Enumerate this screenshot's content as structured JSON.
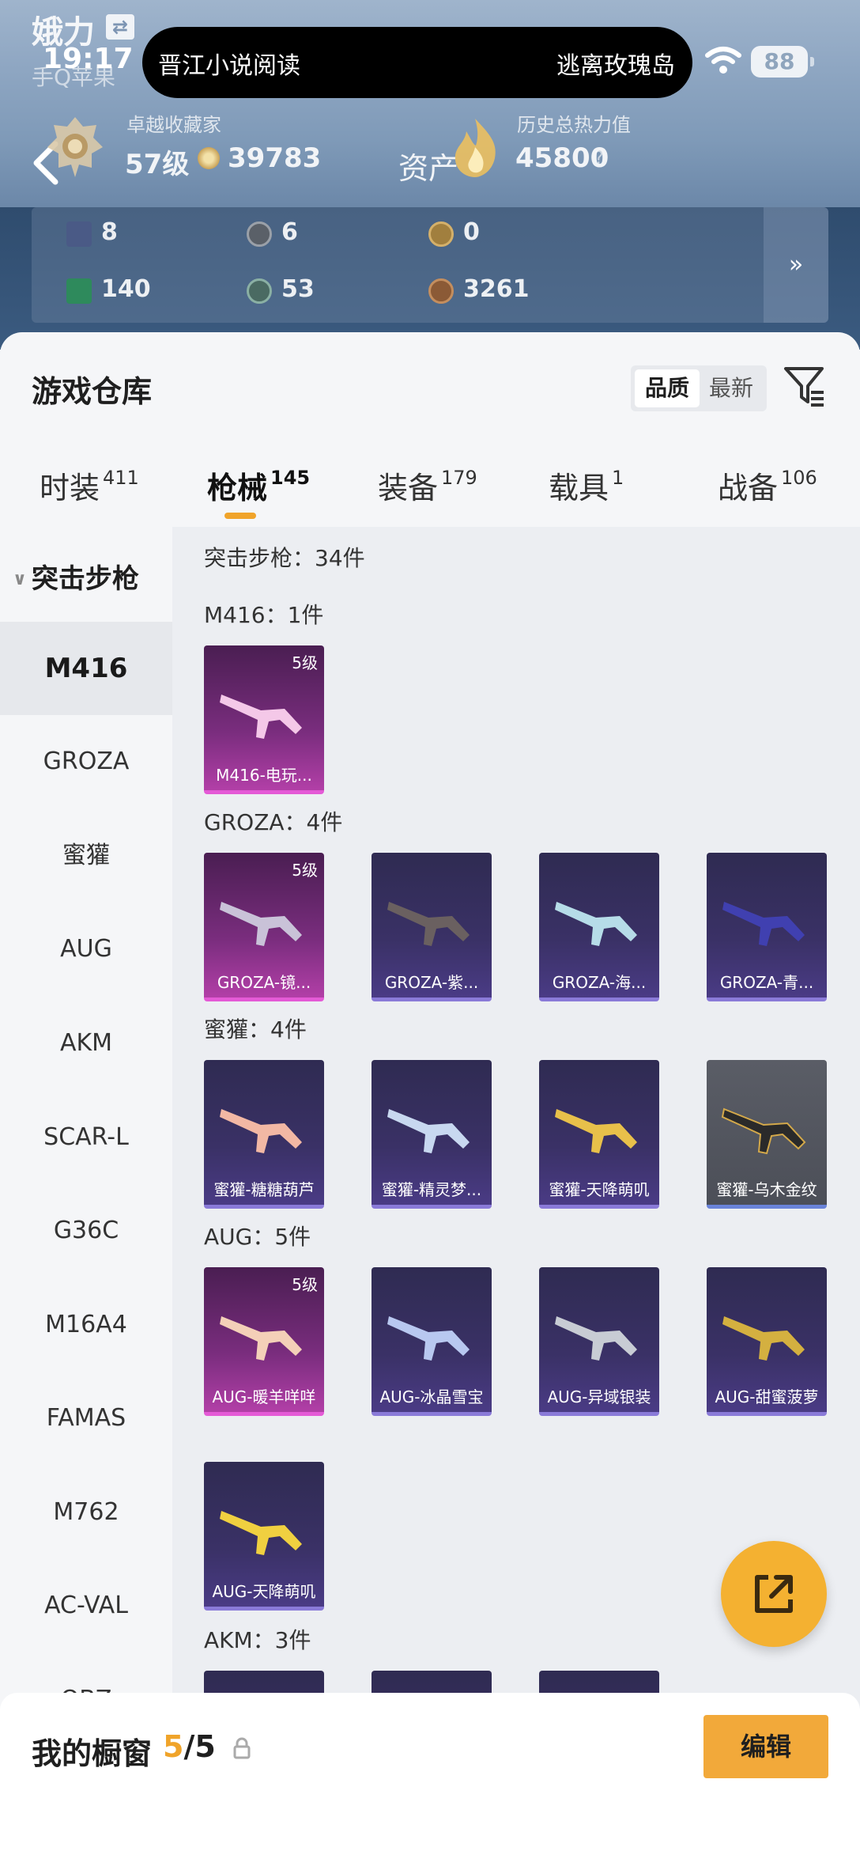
{
  "status_bar": {
    "player_name": "娥力",
    "time": "19:17",
    "subtitle": "手Q苹果",
    "island_left": "晋江小说阅读",
    "island_right": "逃离玫瑰岛",
    "battery": "88"
  },
  "profile": {
    "rank_title": "卓越收藏家",
    "rank_level": "57级",
    "coins": "39783",
    "asset_label": "资产",
    "heat_title": "历史总热力值",
    "heat_value": "45800",
    "heat_q": "?"
  },
  "resources": [
    {
      "icon": "card-icon",
      "value": "8",
      "color": "#4a5a86"
    },
    {
      "icon": "medal-icon",
      "value": "6",
      "color": "#5a6068"
    },
    {
      "icon": "triangle-badge-icon",
      "value": "0",
      "color": "#a17f3e"
    },
    {
      "icon": "green-card-icon",
      "value": "140",
      "color": "#2e8a5c"
    },
    {
      "icon": "orb-icon",
      "value": "53",
      "color": "#4a6a62"
    },
    {
      "icon": "bronze-coin-icon",
      "value": "3261",
      "color": "#8b5a36"
    }
  ],
  "resources_more": "»",
  "warehouse": {
    "title": "游戏仓库",
    "sort_quality": "品质",
    "sort_latest": "最新",
    "tabs": [
      {
        "label": "时装",
        "count": "411"
      },
      {
        "label": "枪械",
        "count": "145"
      },
      {
        "label": "装备",
        "count": "179"
      },
      {
        "label": "载具",
        "count": "1"
      },
      {
        "label": "战备",
        "count": "106"
      }
    ]
  },
  "sidebar": {
    "group": "突击步枪",
    "items": [
      "M416",
      "GROZA",
      "蜜獾",
      "AUG",
      "AKM",
      "SCAR-L",
      "G36C",
      "M16A4",
      "FAMAS",
      "M762",
      "AC-VAL",
      "QBZ"
    ]
  },
  "content": {
    "total": "突击步枪：34件",
    "sections": [
      {
        "label": "M416：1件",
        "cards": [
          {
            "name": "M416-电玩...",
            "level": "5级",
            "rarity": "pink"
          }
        ]
      },
      {
        "label": "GROZA：4件",
        "cards": [
          {
            "name": "GROZA-镜...",
            "level": "5级",
            "rarity": "pink"
          },
          {
            "name": "GROZA-紫...",
            "level": "",
            "rarity": "purple"
          },
          {
            "name": "GROZA-海...",
            "level": "",
            "rarity": "purple"
          },
          {
            "name": "GROZA-青...",
            "level": "",
            "rarity": "purple"
          }
        ]
      },
      {
        "label": "蜜獾：4件",
        "cards": [
          {
            "name": "蜜獾-糖糖葫芦",
            "level": "",
            "rarity": "purple"
          },
          {
            "name": "蜜獾-精灵梦...",
            "level": "",
            "rarity": "purple"
          },
          {
            "name": "蜜獾-天降萌叽",
            "level": "",
            "rarity": "purple"
          },
          {
            "name": "蜜獾-乌木金纹",
            "level": "",
            "rarity": "grey"
          }
        ]
      },
      {
        "label": "AUG：5件",
        "cards": [
          {
            "name": "AUG-暖羊咩咩",
            "level": "5级",
            "rarity": "pink"
          },
          {
            "name": "AUG-冰晶雪宝",
            "level": "",
            "rarity": "purple"
          },
          {
            "name": "AUG-异域银装",
            "level": "",
            "rarity": "purple"
          },
          {
            "name": "AUG-甜蜜菠萝",
            "level": "",
            "rarity": "purple"
          },
          {
            "name": "AUG-天降萌叽",
            "level": "",
            "rarity": "purple"
          }
        ]
      },
      {
        "label": "AKM：3件",
        "cards": []
      }
    ]
  },
  "showcase": {
    "title": "我的橱窗",
    "count_current": "5",
    "count_total": "/5",
    "edit_label": "编辑"
  },
  "colors": {
    "accent": "#f0a42a",
    "pink_rarity": "#b23fa7",
    "purple_rarity": "#4a3b85"
  }
}
